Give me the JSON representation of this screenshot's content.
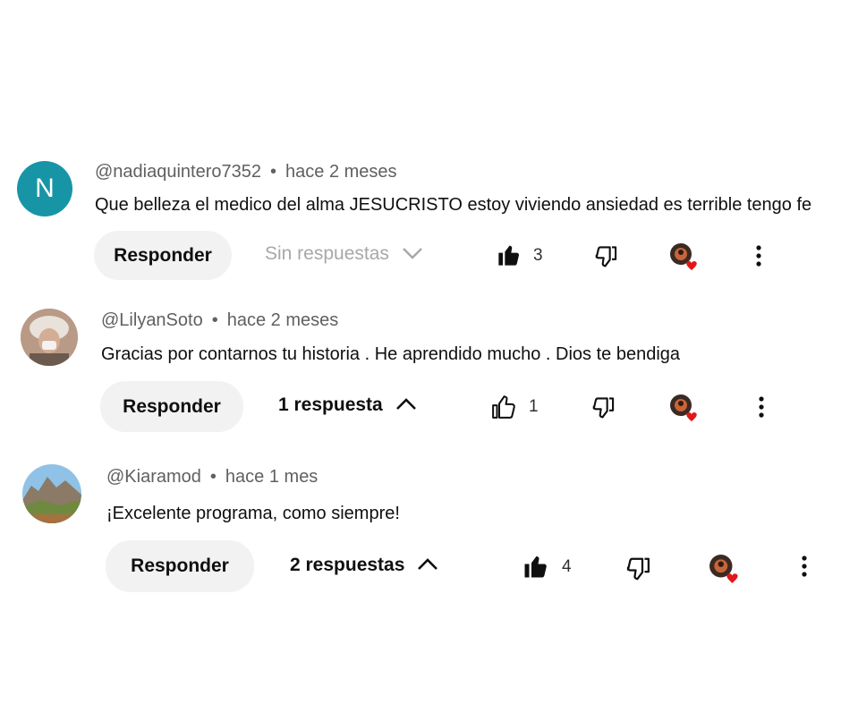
{
  "comments": [
    {
      "handle": "@nadiaquintero7352",
      "time": "hace 2 meses",
      "text": "Que belleza el medico del alma JESUCRISTO estoy viviendo ansiedad es terrible tengo fe",
      "avatar_letter": "N",
      "reply_label": "Responder",
      "replies_label": "Sin respuestas",
      "likes": "3",
      "liked": true
    },
    {
      "handle": "@LilyanSoto",
      "time": "hace 2 meses",
      "text": "Gracias por contarnos tu historia . He aprendido mucho . Dios te bendiga",
      "reply_label": "Responder",
      "replies_label": "1 respuesta",
      "likes": "1",
      "liked": false
    },
    {
      "handle": "@Kiaramod",
      "time": "hace 1 mes",
      "text": "¡Excelente programa, como siempre!",
      "reply_label": "Responder",
      "replies_label": "2 respuestas",
      "likes": "4",
      "liked": true
    }
  ],
  "icons": {
    "like": "thumb-up-icon",
    "dislike": "thumb-down-icon",
    "creator_heart": "creator-heart-icon",
    "more": "more-vert-icon",
    "collapse": "chevron-up-icon",
    "expand": "chevron-down-icon"
  },
  "colors": {
    "avatar_teal": "#1795a6",
    "heart_red": "#e0171b",
    "pill_bg": "#f2f2f2",
    "meta_gray": "#606060"
  }
}
